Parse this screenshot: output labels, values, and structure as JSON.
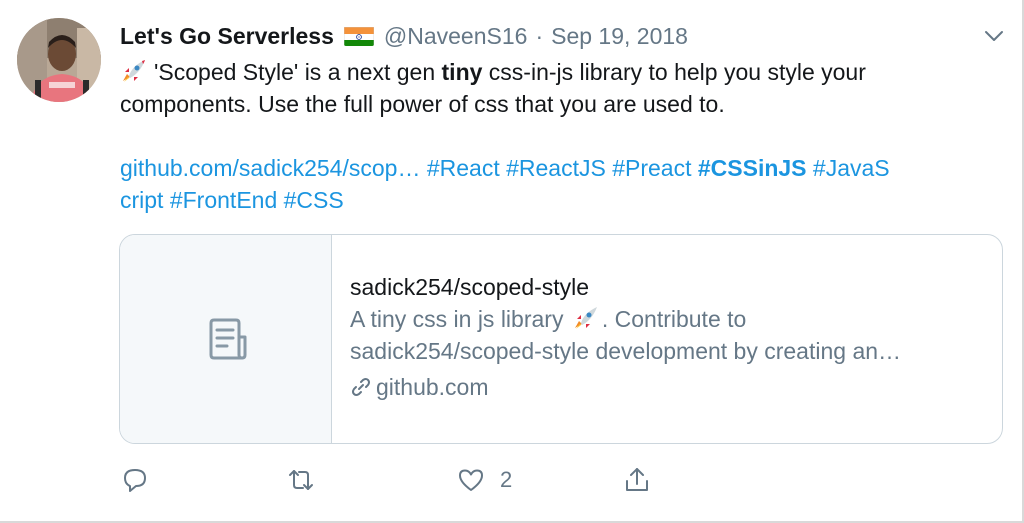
{
  "tweet": {
    "display_name": "Let's Go Serverless",
    "handle": "@NaveenS16",
    "separator": "·",
    "date": "Sep 19, 2018",
    "text": {
      "line1_a": "'Scoped Style' is a next gen ",
      "line1_bold": "tiny",
      "line1_b": " css-in-js library to help you style your",
      "line2": "components. Use the full power of css that you are used to.",
      "link_url": "github.com/sadick254/scop…",
      "tags_line3": [
        "#React",
        "#ReactJS",
        "#Preact"
      ],
      "bold_tag": "#CSSinJS",
      "tag_split_a": "#JavaS",
      "tag_split_b": "cript",
      "tags_line4": [
        "#FrontEnd",
        "#CSS"
      ]
    }
  },
  "card": {
    "title": "sadick254/scoped-style",
    "desc_a": "A tiny css in js library ",
    "desc_b": ". Contribute to",
    "desc_line2": "sadick254/scoped-style development by creating an…",
    "domain": "github.com"
  },
  "actions": {
    "like_count": "2"
  },
  "colors": {
    "link": "#1b95e0",
    "text": "#14171a",
    "muted": "#657786",
    "border": "#ccd6dd"
  },
  "icons": {
    "avatar": "user-avatar",
    "flag": "india-flag-icon",
    "menu": "chevron-down-icon",
    "rocket": "rocket-emoji",
    "card_thumb": "document-icon",
    "domain": "link-icon",
    "reply": "reply-icon",
    "retweet": "retweet-icon",
    "like": "heart-icon",
    "share": "share-icon"
  }
}
